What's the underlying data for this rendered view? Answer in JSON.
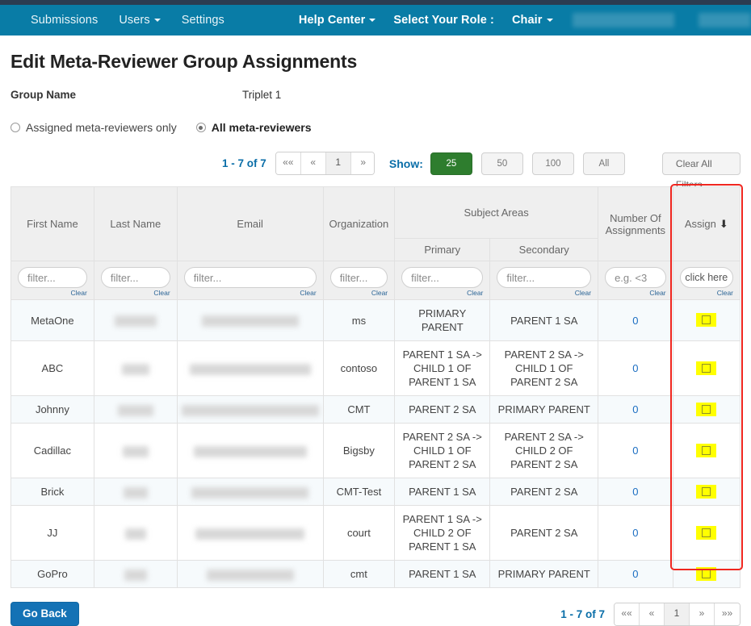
{
  "navbar": {
    "left_items": [
      {
        "label": "Submissions",
        "caret": false
      },
      {
        "label": "Users",
        "caret": true
      },
      {
        "label": "Settings",
        "caret": false
      }
    ],
    "right_items": [
      {
        "label": "Help Center",
        "caret": true
      },
      {
        "label": "Select Your Role :",
        "caret": false
      },
      {
        "label": "Chair",
        "caret": true
      }
    ]
  },
  "page": {
    "title": "Edit Meta-Reviewer Group Assignments",
    "group_name_label": "Group Name",
    "group_name_value": "Triplet 1"
  },
  "filter_mode": {
    "options": [
      {
        "label": "Assigned meta-reviewers only",
        "selected": false
      },
      {
        "label": "All meta-reviewers",
        "selected": true
      }
    ]
  },
  "toolbar": {
    "count_text": "1 - 7 of 7",
    "pager": [
      {
        "label": "««",
        "active": false
      },
      {
        "label": "«",
        "active": false
      },
      {
        "label": "1",
        "active": true
      },
      {
        "label": "»",
        "active": false
      },
      {
        "label": "»»",
        "active": false
      }
    ],
    "show_label": "Show:",
    "show_options": [
      {
        "label": "25",
        "selected": true
      },
      {
        "label": "50",
        "selected": false
      },
      {
        "label": "100",
        "selected": false
      },
      {
        "label": "All",
        "selected": false
      }
    ],
    "clear_all_filters": "Clear All Filters",
    "accent_green": "#2e7d2e",
    "accent_blue": "#0a6ea8"
  },
  "table": {
    "headers": {
      "first_name": "First Name",
      "last_name": "Last Name",
      "email": "Email",
      "organization": "Organization",
      "subject_areas": "Subject Areas",
      "primary": "Primary",
      "secondary": "Secondary",
      "number_of_assignments": "Number Of Assignments",
      "assign": "Assign",
      "assign_sort_icon": "arrow-down-icon"
    },
    "filters": {
      "first_name_placeholder": "filter...",
      "last_name_placeholder": "filter...",
      "email_placeholder": "filter...",
      "organization_placeholder": "filter...",
      "primary_placeholder": "filter...",
      "secondary_placeholder": "filter...",
      "assignments_placeholder": "e.g. <3",
      "assign_button_label": "click here",
      "clear_label": "Clear"
    },
    "rows": [
      {
        "first_name": "MetaOne",
        "last_name_redacted_width": 52,
        "email_redacted_width": 120,
        "organization": "ms",
        "primary": "PRIMARY PARENT",
        "secondary": "PARENT 1 SA",
        "assignments": "0",
        "assign_checked": false
      },
      {
        "first_name": "ABC",
        "last_name_redacted_width": 34,
        "email_redacted_width": 150,
        "organization": "contoso",
        "primary": "PARENT 1 SA -> CHILD 1 OF PARENT 1 SA",
        "secondary": "PARENT 2 SA -> CHILD 1 OF PARENT 2 SA",
        "assignments": "0",
        "assign_checked": false
      },
      {
        "first_name": "Johnny",
        "last_name_redacted_width": 44,
        "email_redacted_width": 170,
        "organization": "CMT",
        "primary": "PARENT 2 SA",
        "secondary": "PRIMARY PARENT",
        "assignments": "0",
        "assign_checked": false
      },
      {
        "first_name": "Cadillac",
        "last_name_redacted_width": 32,
        "email_redacted_width": 140,
        "organization": "Bigsby",
        "primary": "PARENT 2 SA -> CHILD 1 OF PARENT 2 SA",
        "secondary": "PARENT 2 SA -> CHILD 2 OF PARENT 2 SA",
        "assignments": "0",
        "assign_checked": false
      },
      {
        "first_name": "Brick",
        "last_name_redacted_width": 30,
        "email_redacted_width": 145,
        "organization": "CMT-Test",
        "primary": "PARENT 1 SA",
        "secondary": "PARENT 2 SA",
        "assignments": "0",
        "assign_checked": false
      },
      {
        "first_name": "JJ",
        "last_name_redacted_width": 26,
        "email_redacted_width": 135,
        "organization": "court",
        "primary": "PARENT 1 SA -> CHILD 2 OF PARENT 1 SA",
        "secondary": "PARENT 2 SA",
        "assignments": "0",
        "assign_checked": false
      },
      {
        "first_name": "GoPro",
        "last_name_redacted_width": 28,
        "email_redacted_width": 108,
        "organization": "cmt",
        "primary": "PARENT 1 SA",
        "secondary": "PRIMARY PARENT",
        "assignments": "0",
        "assign_checked": false
      }
    ],
    "highlight_color": "#f0261f",
    "checkbox_highlight_color": "#ffff00"
  },
  "footer": {
    "go_back_label": "Go Back",
    "count_text": "1 - 7 of 7",
    "pager": [
      {
        "label": "««",
        "active": false
      },
      {
        "label": "«",
        "active": false
      },
      {
        "label": "1",
        "active": true
      },
      {
        "label": "»",
        "active": false
      },
      {
        "label": "»»",
        "active": false
      }
    ]
  }
}
